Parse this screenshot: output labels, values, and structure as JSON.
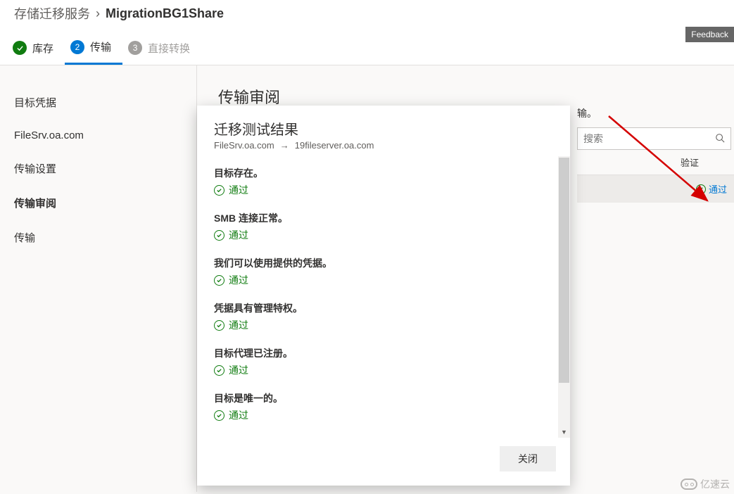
{
  "breadcrumb": {
    "service": "存储迁移服务",
    "current": "MigrationBG1Share",
    "separator": "›"
  },
  "feedback": {
    "label": "Feedback"
  },
  "steps": [
    {
      "label": "库存",
      "num": "✓",
      "state": "done"
    },
    {
      "label": "传输",
      "num": "2",
      "state": "active"
    },
    {
      "label": "直接转换",
      "num": "3",
      "state": "disabled"
    }
  ],
  "sidebar": {
    "items": [
      {
        "label": "目标凭据"
      },
      {
        "label": "FileSrv.oa.com"
      },
      {
        "label": "传输设置"
      },
      {
        "label": "传输审阅",
        "active": true
      },
      {
        "label": "传输"
      }
    ]
  },
  "main": {
    "title": "传输审阅",
    "desc_tail": "输。"
  },
  "search": {
    "placeholder": "搜索"
  },
  "table": {
    "col_validate": "验证",
    "row": {
      "status": "通过"
    }
  },
  "modal": {
    "title": "迁移测试结果",
    "source": "FileSrv.oa.com",
    "target": "19fileserver.oa.com",
    "results": [
      {
        "label": "目标存在。",
        "status": "通过"
      },
      {
        "label": "SMB 连接正常。",
        "status": "通过"
      },
      {
        "label": "我们可以使用提供的凭据。",
        "status": "通过"
      },
      {
        "label": "凭据具有管理特权。",
        "status": "通过"
      },
      {
        "label": "目标代理已注册。",
        "status": "通过"
      },
      {
        "label": "目标是唯一的。",
        "status": "通过"
      }
    ],
    "close_label": "关闭"
  },
  "watermark": "亿速云"
}
